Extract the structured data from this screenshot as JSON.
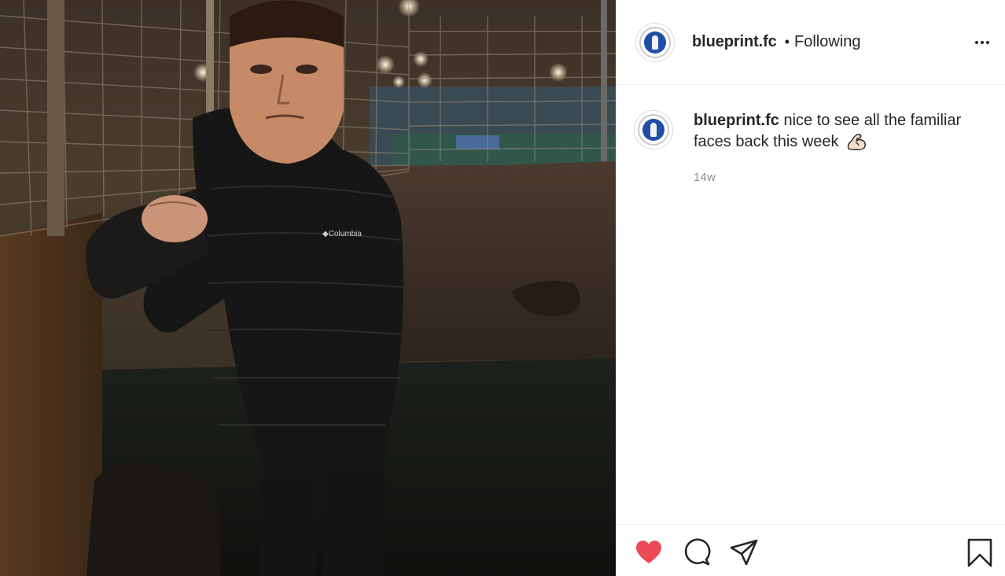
{
  "post": {
    "username": "blueprint.fc",
    "separator": "•",
    "follow_state": "Following",
    "caption_username": "blueprint.fc",
    "caption_text": "nice to see all the familiar faces back this week",
    "caption_emoji": "flexed-biceps",
    "timestamp": "14w",
    "liked": true
  },
  "colors": {
    "like": "#ed4956",
    "text": "#262626",
    "muted": "#8e8e8e",
    "divider": "#efefef",
    "avatar_blue": "#1f4fa8"
  },
  "icons": {
    "more": "more-options-icon",
    "like": "heart-icon",
    "comment": "comment-icon",
    "share": "paper-plane-icon",
    "save": "bookmark-icon"
  }
}
